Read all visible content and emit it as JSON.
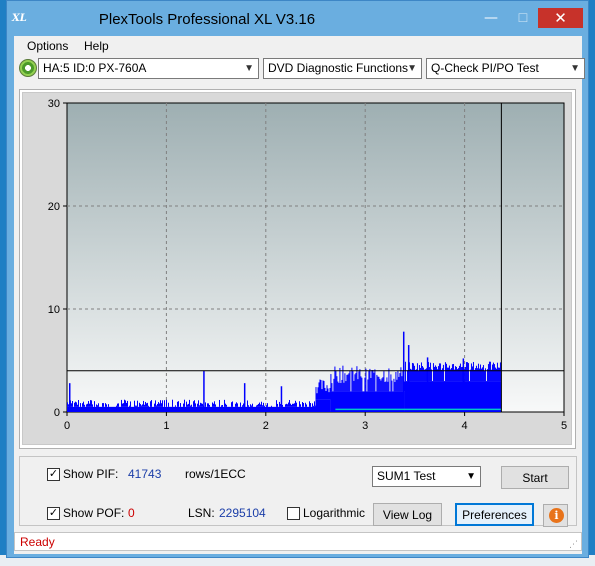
{
  "window": {
    "title": "PlexTools Professional XL V3.16",
    "app_icon_text": "XL",
    "min_glyph": "—",
    "max_glyph": "☐",
    "close_glyph": "✕"
  },
  "menu": {
    "options": "Options",
    "help": "Help"
  },
  "toolbar": {
    "drive": "HA:5 ID:0  PX-760A",
    "function": "DVD Diagnostic Functions",
    "test": "Q-Check PI/PO Test",
    "dropdown_glyph": "▼"
  },
  "chart_data": {
    "type": "bar",
    "x_ticks": [
      "0",
      "1",
      "2",
      "3",
      "4",
      "5"
    ],
    "y_ticks": [
      "0",
      "10",
      "20",
      "30"
    ],
    "xlim": [
      0,
      5
    ],
    "ylim": [
      0,
      30
    ],
    "grid": true,
    "threshold_line": 4,
    "end_marker_x": 4.37,
    "colors": {
      "bars": "#0000ff",
      "baseline": "#00c8c8",
      "plot_top": "#9eafb2",
      "plot_bottom": "#f8f9f9",
      "grid": "#808080"
    },
    "series": [
      {
        "segments": [
          {
            "x_start": 0.0,
            "x_end": 2.5,
            "base": 0.5,
            "spike_min": 0.6,
            "spike_max": 1.2,
            "density": 0.6
          },
          {
            "x_start": 2.5,
            "x_end": 2.65,
            "base": 1.2,
            "spike_min": 1.8,
            "spike_max": 3.2,
            "density": 0.9
          },
          {
            "x_start": 2.65,
            "x_end": 3.4,
            "base": 2.0,
            "spike_min": 2.8,
            "spike_max": 4.5,
            "density": 0.9
          },
          {
            "x_start": 3.4,
            "x_end": 4.37,
            "base": 3.0,
            "spike_min": 4.0,
            "spike_max": 4.9,
            "density": 0.95
          }
        ],
        "peaks": [
          {
            "x": 0.02,
            "y": 2.8
          },
          {
            "x": 1.37,
            "y": 4.0
          },
          {
            "x": 1.78,
            "y": 2.8
          },
          {
            "x": 2.15,
            "y": 2.5
          },
          {
            "x": 3.38,
            "y": 7.8
          },
          {
            "x": 3.43,
            "y": 6.5
          },
          {
            "x": 3.62,
            "y": 5.3
          },
          {
            "x": 3.98,
            "y": 5.2
          }
        ]
      }
    ]
  },
  "controls": {
    "show_pif_label": "Show PIF:",
    "pif_value": "41743",
    "rows_label": "rows/1ECC",
    "show_pof_label": "Show POF:",
    "pof_value": "0",
    "lsn_label": "LSN:",
    "lsn_value": "2295104",
    "logarithmic_label": "Logarithmic",
    "sum_test": "SUM1 Test",
    "start_button": "Start",
    "view_log_button": "View Log",
    "preferences_button": "Preferences",
    "check_glyph": "✓",
    "info_glyph": "i"
  },
  "status": {
    "text": "Ready",
    "grip_glyph": "⋰"
  }
}
